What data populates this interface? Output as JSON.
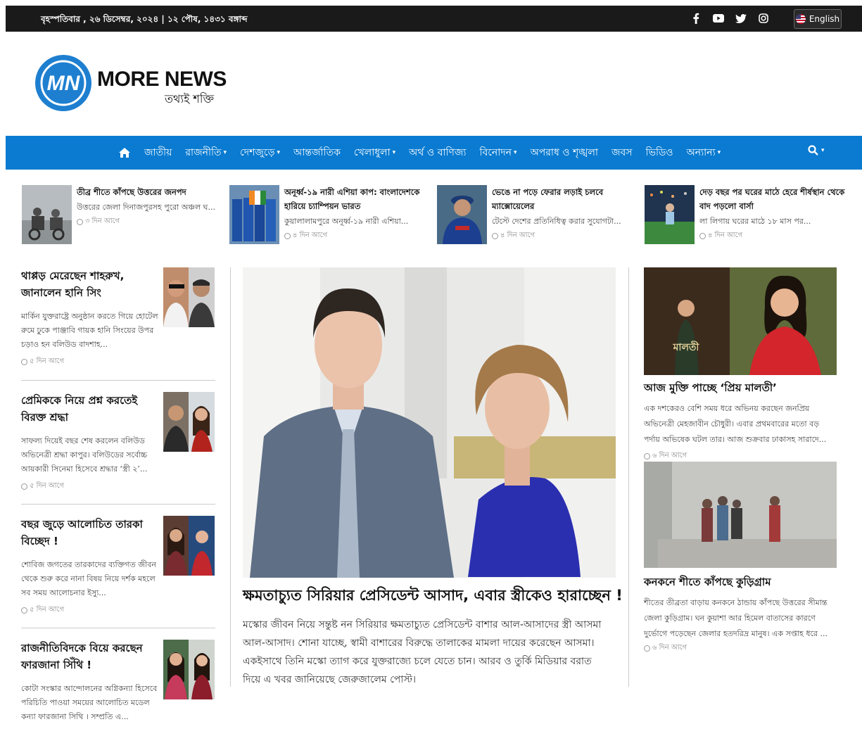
{
  "topbar": {
    "date": "বৃহস্পতিবার , ২৬ ডিসেম্বর, ২০২৪ | ১২ পৌষ, ১৪৩১ বঙ্গাব্দ",
    "social": [
      "facebook-icon",
      "youtube-icon",
      "twitter-icon",
      "instagram-icon"
    ],
    "language": "English"
  },
  "logo": {
    "mark": "MN",
    "title": "MORE NEWS",
    "tagline": "তথ্যই শক্তি"
  },
  "nav": {
    "items": [
      {
        "label": "জাতীয়",
        "dropdown": false
      },
      {
        "label": "রাজনীতি",
        "dropdown": true
      },
      {
        "label": "দেশজুড়ে",
        "dropdown": true
      },
      {
        "label": "আন্তর্জাতিক",
        "dropdown": false
      },
      {
        "label": "খেলাধুলা",
        "dropdown": true
      },
      {
        "label": "অর্থ ও বাণিজ্য",
        "dropdown": false
      },
      {
        "label": "বিনোদন",
        "dropdown": true
      },
      {
        "label": "অপরাধ ও শৃঙ্খলা",
        "dropdown": false
      },
      {
        "label": "জবস",
        "dropdown": false
      },
      {
        "label": "ভিডিও",
        "dropdown": false
      },
      {
        "label": "অন্যান্য",
        "dropdown": true
      }
    ],
    "caret": "▾",
    "search_icon": "search-icon",
    "colors": {
      "bar": "#0a7bd1"
    }
  },
  "strip": [
    {
      "title": "তীব্র শীতে কাঁপছে উত্তরের জনপদ",
      "excerpt": "উত্তরের জেলা দিনাজপুরসহ পুরো অঞ্চল ঘ...",
      "time": "৩ দিন আগে"
    },
    {
      "title": "অনূর্ধ্ব-১৯ নারী এশিয়া কাপ: বাংলাদেশকে হারিয়ে চ্যাম্পিয়ন ভারত",
      "excerpt": "কুয়ালালামপুরে অনূর্ধ্ব-১৯ নারী এশিয়া...",
      "time": "৪ দিন আগে"
    },
    {
      "title": "ভেঙে না পড়ে ফেরার লড়াই চলবে ম্যাক্সোয়েলের",
      "excerpt": "টেস্টে দেশের প্রতিনিধিত্ব করার সুযোগটা...",
      "time": "৪ দিন আগে"
    },
    {
      "title": "দেড় বছর পর ঘরের মাঠে হেরে শীর্ষস্থান থেকে বাদ পড়লো বার্সা",
      "excerpt": "লা লিগায় ঘরের মাঠে ১৮ মাস পর...",
      "time": "৪ দিন আগে"
    }
  ],
  "left": [
    {
      "title": "থাপ্পড় মেরেছেন শাহরুখ, জানালেন হানি সিং",
      "excerpt": "মার্কিন যুক্তরাষ্ট্রে অনুষ্ঠান করতে গিয়ে হোটেল রুমে ঢুকে পাঞ্জাবি গায়ক হানি সিংয়ের উপর চড়াও হন বলিউড বাদশাহ...",
      "time": "৫ দিন আগে"
    },
    {
      "title": "প্রেমিককে নিয়ে প্রশ্ন করতেই বিরক্ত শ্রদ্ধা",
      "excerpt": "সাফল্য দিয়েই বছর শেষ করলেন বলিউড অভিনেত্রী শ্রদ্ধা কাপুর। বলিউডের সর্বোচ্চ আয়কারী সিনেমা হিসেবে শ্রদ্ধার ‘স্ত্রী ২’...",
      "time": "৫ দিন আগে"
    },
    {
      "title": "বছর জুড়ে আলোচিত তারকা বিচ্ছেদ !",
      "excerpt": "শোবিজ জগতের তারকাদের ব্যক্তিগত জীবন থেকে শুরু করে নানা বিষয় নিয়ে দর্শক মহলে সব সময় আলোচনার ইস্যু...",
      "time": "৫ দিন আগে"
    },
    {
      "title": "রাজনীতিবিদকে বিয়ে করছেন ফারজানা সিঁথি !",
      "excerpt": "কোটা সংস্কার আন্দোলনের অগ্নিকন্যা হিসেবে পরিচিতি পাওয়া সময়ের আলোচিত মডেল কন্যা ফারজানা সিথি । সম্প্রতি এ...",
      "time": ""
    }
  ],
  "hero": {
    "title": "ক্ষমতাচ্যুত সিরিয়ার প্রেসিডেন্ট আসাদ, এবার স্ত্রীকেও হারাচ্ছেন !",
    "excerpt": "মস্কোর জীবন নিয়ে সন্তুষ্ট নন সিরিয়ার ক্ষমতাচ্যুত প্রেসিডেন্ট বাশার আল-আসাদের স্ত্রী আসমা আল-আসাদ। শোনা যাচ্ছে, স্বামী বাশারের বিরুদ্ধে তালাকের মামলা দায়ের করেছেন আসমা। একইসাথে তিনি মস্কো ত্যাগ করে যুক্তরাজ্যে চলে যেতে চান। আরব ও তুর্কি মিডিয়ার বরাত দিয়ে এ খবর জানিয়েছে জেরুজালেম পোস্ট।"
  },
  "right": [
    {
      "title": "আজ মুক্তি পাচ্ছে ‘প্রিয় মালতী’",
      "excerpt": "এক দশকেরও বেশি সময় ধরে অভিনয় করছেন জনপ্রিয় অভিনেত্রী মেহজাবীন চৌধুরী। এবার প্রথমবারের মতো বড় পর্দায় অভিষেক ঘটল তার। আজ শুক্রবার ঢাকাসহ সারাদে...",
      "time": "৬ দিন আগে",
      "poster_text": "মালতী"
    },
    {
      "title": "কনকনে শীতে কাঁপছে কুড়িগ্রাম",
      "excerpt": "শীতের তীব্রতা বাড়ায় কনকনে ঠান্ডায় কাঁপছে উত্তরের সীমান্ত জেলা কুড়িগ্রাম। ঘন কুয়াশা আর হিমেল বাতাসের কারণে দুর্ভোগে পড়েছেন জেলার হতদরিদ্র মানুষ। এক সপ্তাহ ধরে ...",
      "time": "৬ দিন আগে"
    }
  ]
}
